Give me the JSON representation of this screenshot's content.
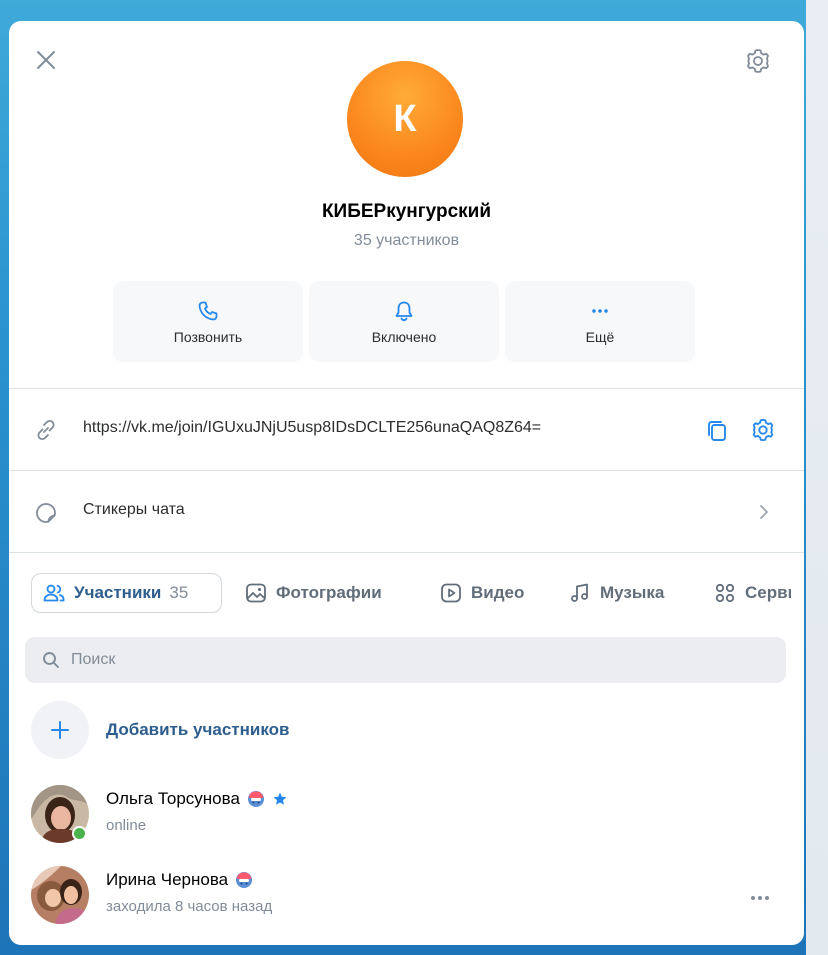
{
  "chat": {
    "avatar_letter": "К",
    "title": "КИБЕРкунгурский",
    "members_count": "35 участников"
  },
  "actions": {
    "call_label": "Позвонить",
    "notifications_label": "Включено",
    "more_label": "Ещё"
  },
  "invite_link": "https://vk.me/join/IGUxuJNjU5usp8IDsDCLTE256unaQAQ8Z64=",
  "stickers_label": "Стикеры чата",
  "tabs": [
    {
      "label": "Участники",
      "count": "35"
    },
    {
      "label": "Фотографии"
    },
    {
      "label": "Видео"
    },
    {
      "label": "Музыка"
    },
    {
      "label": "Сервисы"
    }
  ],
  "search": {
    "placeholder": "Поиск"
  },
  "add_members_label": "Добавить участников",
  "members": [
    {
      "name": "Ольга Торсунова",
      "status": "online"
    },
    {
      "name": "Ирина Чернова",
      "status": "заходила 8 часов назад"
    }
  ],
  "colors": {
    "accent": "#2d5e8e",
    "icon_blue": "#2688eb",
    "avatar_orange": "#fb8a1f",
    "online_green": "#4bb34b",
    "secondary_text": "#818c99"
  }
}
